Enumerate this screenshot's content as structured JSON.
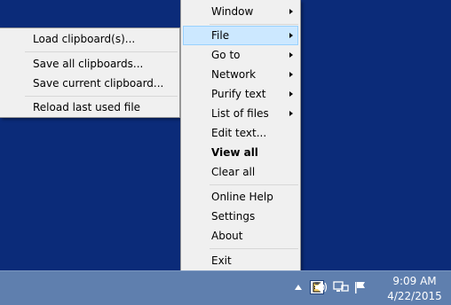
{
  "main_menu": {
    "items": [
      {
        "label": "Window",
        "submenu": true
      },
      {
        "label": "File",
        "submenu": true,
        "highlighted": true
      },
      {
        "label": "Go to",
        "submenu": true
      },
      {
        "label": "Network",
        "submenu": true
      },
      {
        "label": "Purify text",
        "submenu": true
      },
      {
        "label": "List of files",
        "submenu": true
      },
      {
        "label": "Edit text...",
        "submenu": false
      },
      {
        "label": "View all",
        "submenu": false,
        "bold": true
      },
      {
        "label": "Clear all",
        "submenu": false
      },
      {
        "label": "Online Help",
        "submenu": false
      },
      {
        "label": "Settings",
        "submenu": false
      },
      {
        "label": "About",
        "submenu": false
      },
      {
        "label": "Exit",
        "submenu": false
      }
    ]
  },
  "file_submenu": {
    "items": [
      {
        "label": "Load clipboard(s)..."
      },
      {
        "label": "Save all clipboards..."
      },
      {
        "label": "Save current clipboard..."
      },
      {
        "label": "Reload last used file"
      }
    ]
  },
  "taskbar": {
    "time": "9:09 AM",
    "date": "4/22/2015",
    "tray_icons": [
      "chevron-up-icon",
      "clipboard-app-icon",
      "speaker-icon",
      "network-icon",
      "action-center-flag-icon"
    ]
  },
  "colors": {
    "desktop": "#0b2b79",
    "taskbar": "#5f7fae",
    "menu_bg": "#f0f0f0",
    "highlight": "#cce8ff",
    "highlight_border": "#99d1ff"
  }
}
